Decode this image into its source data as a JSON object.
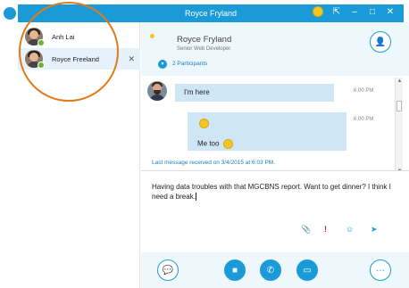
{
  "window": {
    "title": "Royce Fryland"
  },
  "titlebar_icons": [
    "smiley-icon",
    "pin-icon",
    "minimize-icon",
    "maximize-icon",
    "close-icon"
  ],
  "titlebar_glyphs": {
    "pin": "⇱",
    "minimize": "–",
    "maximize": "□",
    "close": "✕"
  },
  "conversations": [
    {
      "name": "Anh Lai",
      "presence": "available"
    },
    {
      "name": "Royce Freeland",
      "presence": "available",
      "close": "✕"
    }
  ],
  "header": {
    "contact_name": "Royce Fryland",
    "contact_title": "Senior Web Developer",
    "participants": "2 Participants"
  },
  "messages": [
    {
      "text": "I'm here",
      "time": "6:00 PM"
    },
    {
      "text": "Me too",
      "time": "6:00 PM"
    }
  ],
  "status": {
    "last_received": "Last message received on 3/4/2015 at 6:03 PM."
  },
  "compose": {
    "text": "Having data troubles with that MGCBNS report. Want to get dinner? I think I need a break."
  },
  "compose_tools": {
    "attach": "📎",
    "important": "!",
    "emoticon": "☺",
    "send": "➤"
  },
  "controls": {
    "im": "💬",
    "video": "■",
    "call": "✆",
    "present": "▭",
    "more": "···"
  },
  "colors": {
    "accent": "#1a9bd7",
    "bubble": "#cfe6f6",
    "annotation": "#e07b1c",
    "presence": "#6bb42f"
  }
}
